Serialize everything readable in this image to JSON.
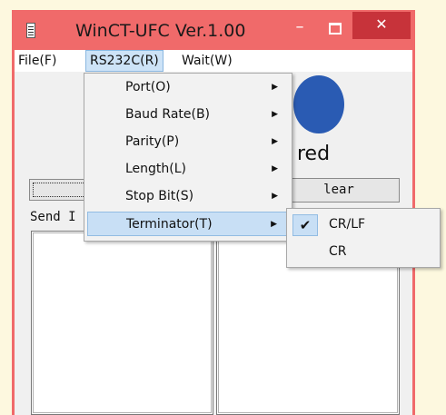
{
  "window": {
    "title": "WinCT-UFC  Ver.1.00",
    "minimize_glyph": "–",
    "close_glyph": "✕",
    "colors": {
      "frame": "#f06a6a",
      "close_button": "#c7333a",
      "menu_highlight": "#cde3f7"
    }
  },
  "menubar": {
    "items": [
      {
        "label": "File(F)"
      },
      {
        "label": "RS232C(R)",
        "active": true
      },
      {
        "label": "Wait(W)"
      }
    ]
  },
  "rs232c_menu": {
    "items": [
      {
        "label": "Port(O)",
        "arrow": "▶"
      },
      {
        "label": "Baud Rate(B)",
        "arrow": "▶"
      },
      {
        "label": "Parity(P)",
        "arrow": "▶"
      },
      {
        "label": "Length(L)",
        "arrow": "▶"
      },
      {
        "label": "Stop Bit(S)",
        "arrow": "▶"
      },
      {
        "label": "Terminator(T)",
        "arrow": "▶",
        "highlighted": true
      }
    ]
  },
  "terminator_submenu": {
    "items": [
      {
        "label": "CR/LF",
        "checked": true,
        "check_glyph": "✔"
      },
      {
        "label": "CR",
        "checked": false
      }
    ]
  },
  "client": {
    "logo_text": "red",
    "clear_button": "lear",
    "send_label": "Send I"
  },
  "icons": [
    "app-icon",
    "minimize-icon",
    "maximize-icon",
    "close-icon",
    "submenu-arrow-icon",
    "checkmark-icon"
  ]
}
